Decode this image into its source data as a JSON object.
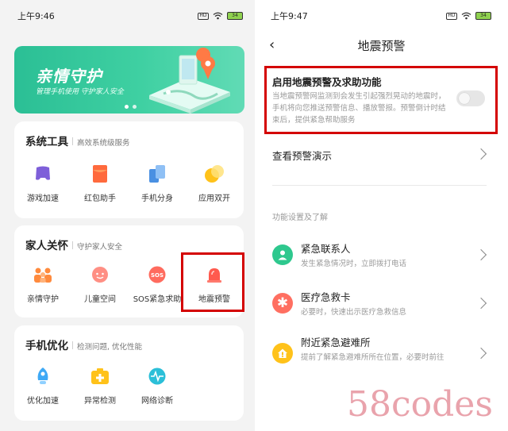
{
  "left": {
    "status": {
      "time": "上午9:46",
      "battery": "34"
    },
    "banner": {
      "title": "亲情守护",
      "subtitle": "管理手机使用 守护家人安全"
    },
    "cards": [
      {
        "title": "系统工具",
        "subtitle": "高效系统级服务",
        "tiles": [
          {
            "label": "游戏加速",
            "icon": "gamepad-icon",
            "color": "#7e5fd9"
          },
          {
            "label": "红包助手",
            "icon": "red-packet-icon",
            "color": "#ff6a3d"
          },
          {
            "label": "手机分身",
            "icon": "phone-clone-icon",
            "color": "#4a90e2"
          },
          {
            "label": "应用双开",
            "icon": "dual-app-icon",
            "color": "#ffc21a"
          }
        ]
      },
      {
        "title": "家人关怀",
        "subtitle": "守护家人安全",
        "tiles": [
          {
            "label": "亲情守护",
            "icon": "family-icon",
            "color": "#ff8a3d"
          },
          {
            "label": "儿童空间",
            "icon": "child-face-icon",
            "color": "#ff6f61"
          },
          {
            "label": "SOS紧急求助",
            "icon": "sos-icon",
            "color": "#ff5a4e"
          },
          {
            "label": "地震预警",
            "icon": "alarm-light-icon",
            "color": "#ff5a4e"
          }
        ]
      },
      {
        "title": "手机优化",
        "subtitle": "检测问题, 优化性能",
        "tiles": [
          {
            "label": "优化加速",
            "icon": "rocket-icon",
            "color": "#3fa9f5"
          },
          {
            "label": "异常检测",
            "icon": "medical-kit-icon",
            "color": "#ffc21a"
          },
          {
            "label": "网络诊断",
            "icon": "pulse-icon",
            "color": "#2bbfd8"
          }
        ]
      }
    ]
  },
  "right": {
    "status": {
      "time": "上午9:47",
      "battery": "34"
    },
    "title": "地震预警",
    "option": {
      "title": "启用地震预警及求助功能",
      "desc": "当地震预警网监测到会发生引起强烈晃动的地震时，手机将向您推送预警信息、播放警报。预警倒计时结束后，提供紧急帮助服务",
      "enabled": false
    },
    "demo_link": "查看预警演示",
    "section": "功能设置及了解",
    "items": [
      {
        "title": "紧急联系人",
        "desc": "发生紧急情况时，立即拨打电话",
        "icon": "person-icon",
        "color": "#2ec88e"
      },
      {
        "title": "医疗急救卡",
        "desc": "必要时，快速出示医疗急救信息",
        "icon": "asterisk-icon",
        "color": "#ff6f61"
      },
      {
        "title": "附近紧急避难所",
        "desc": "提前了解紧急避难所所在位置，必要时前往",
        "icon": "shelter-icon",
        "color": "#ffc21a"
      }
    ]
  },
  "watermark": "58codes",
  "colors": {
    "highlight": "#d40000",
    "banner": "#2bbf95"
  }
}
